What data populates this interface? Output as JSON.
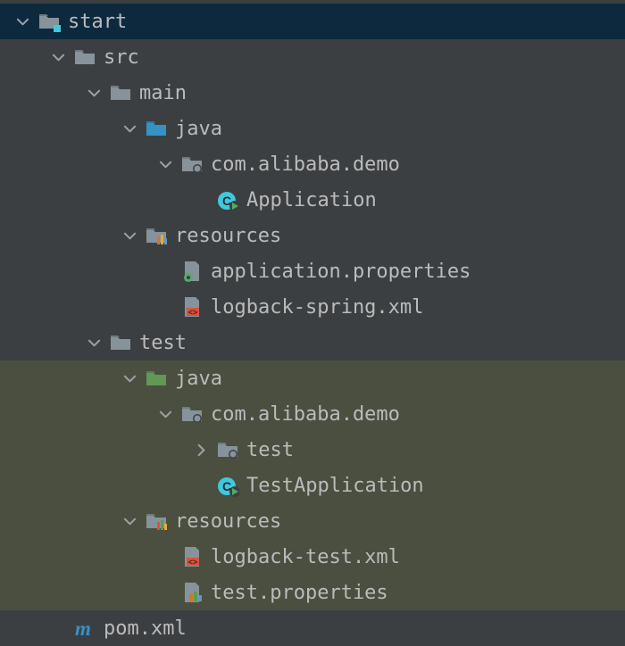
{
  "tree": {
    "root": "start",
    "src": "src",
    "main": "main",
    "main_java": "java",
    "main_pkg": "com.alibaba.demo",
    "main_app": "Application",
    "main_resources": "resources",
    "main_prop": "application.properties",
    "main_logback": "logback-spring.xml",
    "test": "test",
    "test_java": "java",
    "test_pkg": "com.alibaba.demo",
    "test_test": "test",
    "test_app": "TestApplication",
    "test_resources": "resources",
    "test_logback": "logback-test.xml",
    "test_prop": "test.properties",
    "pom": "pom.xml"
  }
}
